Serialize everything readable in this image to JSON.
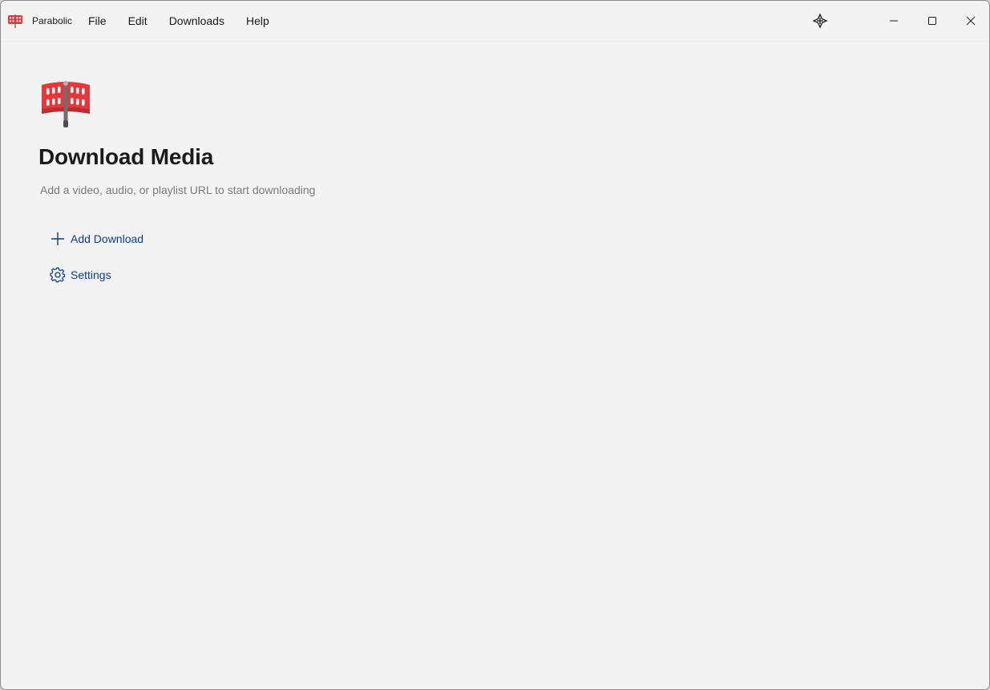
{
  "window": {
    "app_name": "Parabolic",
    "menu": [
      "File",
      "Edit",
      "Downloads",
      "Help"
    ],
    "controls": {
      "pin_icon": "move-icon",
      "minimize_icon": "minimize-icon",
      "maximize_icon": "maximize-icon",
      "close_icon": "close-icon"
    }
  },
  "main": {
    "title": "Download Media",
    "subtitle": "Add a video, audio, or playlist URL to start downloading",
    "actions": {
      "add_download": "Add Download",
      "settings": "Settings"
    }
  },
  "colors": {
    "accent": "#0a3d8a",
    "icon_red": "#e8373a",
    "background": "#f3f3f3"
  }
}
